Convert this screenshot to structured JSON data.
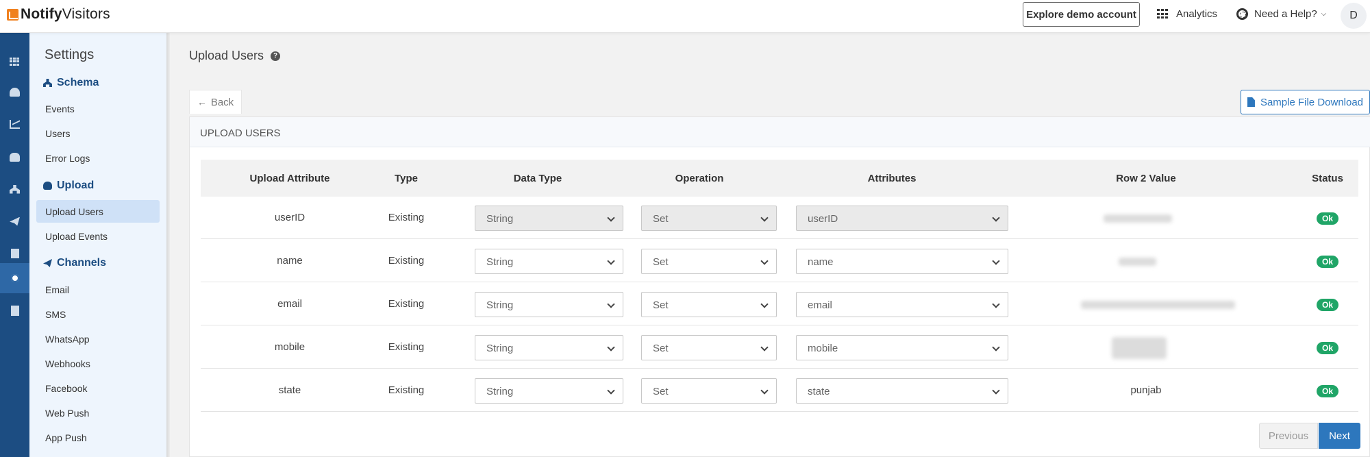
{
  "header": {
    "logo_bold": "Notify",
    "logo_rest": "Visitors",
    "explore_label": "Explore demo account",
    "analytics_label": "Analytics",
    "help_label": "Need a Help?",
    "avatar_initial": "D"
  },
  "sidebar": {
    "title": "Settings",
    "schema": {
      "label": "Schema",
      "items": [
        "Events",
        "Users",
        "Error Logs"
      ]
    },
    "upload": {
      "label": "Upload",
      "items": [
        "Upload Users",
        "Upload Events"
      ],
      "active": "Upload Users"
    },
    "channels": {
      "label": "Channels",
      "items": [
        "Email",
        "SMS",
        "WhatsApp",
        "Webhooks",
        "Facebook",
        "Web Push",
        "App Push"
      ]
    }
  },
  "page": {
    "title": "Upload Users",
    "back_label": "Back",
    "sample_label": "Sample File Download",
    "panel_title": "UPLOAD USERS"
  },
  "table": {
    "headers": [
      "Upload Attribute",
      "Type",
      "Data Type",
      "Operation",
      "Attributes",
      "Row 2 Value",
      "Status"
    ],
    "rows": [
      {
        "attribute": "userID",
        "type": "Existing",
        "data_type": "String",
        "operation": "Set",
        "target": "userID",
        "value": "",
        "status": "Ok",
        "locked": true
      },
      {
        "attribute": "name",
        "type": "Existing",
        "data_type": "String",
        "operation": "Set",
        "target": "name",
        "value": "",
        "status": "Ok",
        "locked": false
      },
      {
        "attribute": "email",
        "type": "Existing",
        "data_type": "String",
        "operation": "Set",
        "target": "email",
        "value": "",
        "status": "Ok",
        "locked": false
      },
      {
        "attribute": "mobile",
        "type": "Existing",
        "data_type": "String",
        "operation": "Set",
        "target": "mobile",
        "value": "",
        "status": "Ok",
        "locked": false
      },
      {
        "attribute": "state",
        "type": "Existing",
        "data_type": "String",
        "operation": "Set",
        "target": "state",
        "value": "punjab",
        "status": "Ok",
        "locked": false
      }
    ]
  },
  "pagination": {
    "previous_label": "Previous",
    "next_label": "Next"
  },
  "colors": {
    "rail": "#1c4d82",
    "accent": "#2d77bd",
    "ok": "#20a567",
    "sidebar_bg": "#eef5fd"
  }
}
